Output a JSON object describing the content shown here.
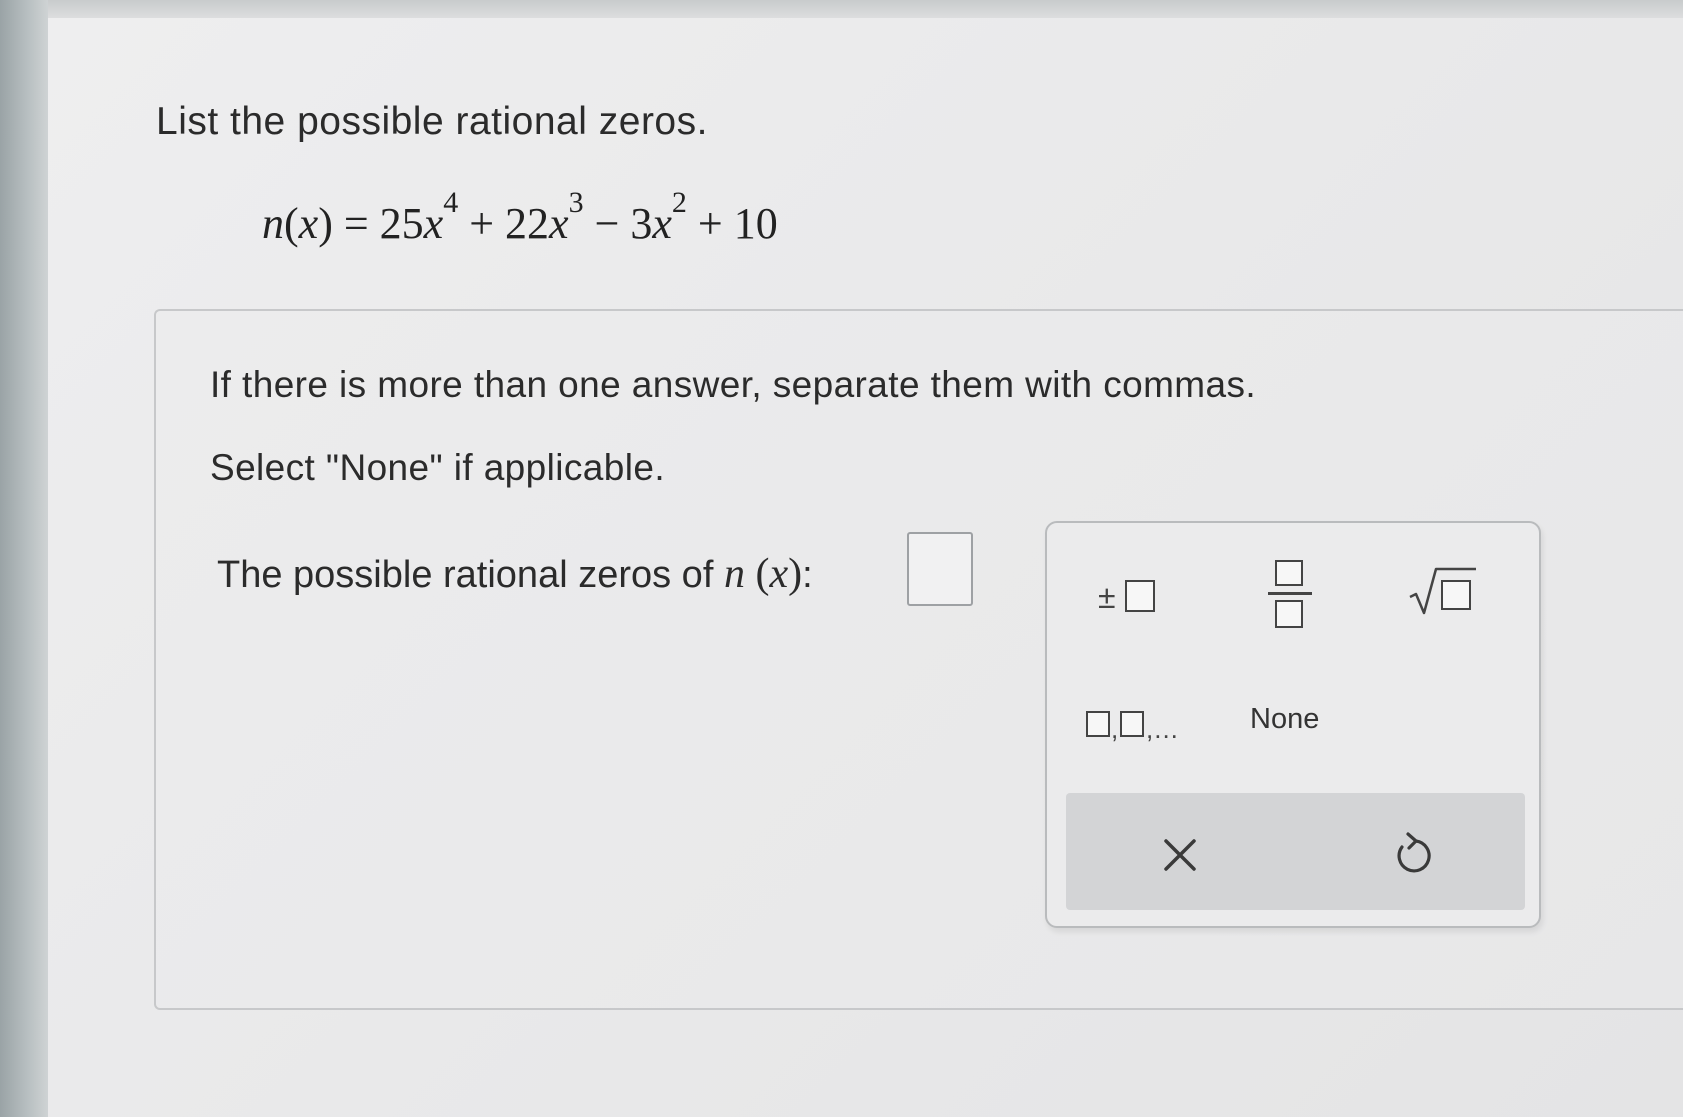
{
  "question": {
    "title": "List the possible rational zeros."
  },
  "equation": {
    "func": "n",
    "lparen": "(",
    "var": "x",
    "rparen": ")",
    "equals": " = 25",
    "x1": "x",
    "exp1": "4",
    "mid1": " + 22",
    "x2": "x",
    "exp2": "3",
    "mid2": " − 3",
    "x3": "x",
    "exp3": "2",
    "tail": " + 10"
  },
  "instructions": {
    "line1": "If there is more than one answer, separate them with commas.",
    "line2": "Select \"None\" if applicable."
  },
  "prompt": {
    "label": "The possible rational zeros of ",
    "func": "n",
    "lparen": " (",
    "var": "x",
    "rparen": ")",
    "colon": ":"
  },
  "answer": {
    "value": ""
  },
  "palette": {
    "plusminus_symbol": "±",
    "list_comma": ",",
    "list_tail": ",...",
    "none_label": "None",
    "clear_icon": "x-icon",
    "undo_icon": "undo-icon"
  }
}
